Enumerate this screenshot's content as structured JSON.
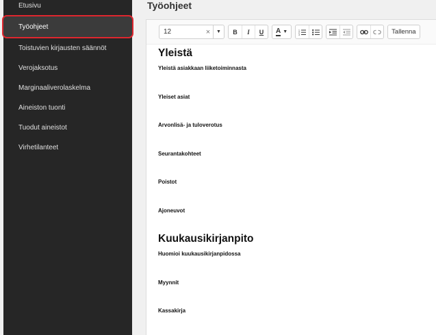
{
  "sidebar": {
    "items": [
      {
        "label": "Etusivu"
      },
      {
        "label": "Työohjeet",
        "active": true
      },
      {
        "label": "Toistuvien kirjausten säännöt"
      },
      {
        "label": "Verojaksotus"
      },
      {
        "label": "Marginaaliverolaskelma"
      },
      {
        "label": "Aineiston tuonti"
      },
      {
        "label": "Tuodut aineistot"
      },
      {
        "label": "Virhetilanteet"
      }
    ]
  },
  "page": {
    "title": "Työohjeet"
  },
  "toolbar": {
    "font_size": "12",
    "clear_glyph": "×",
    "dropdown_glyph": "▼",
    "bold": "B",
    "italic": "I",
    "underline": "U",
    "text_color": "A",
    "save_label": "Tallenna",
    "icons": [
      "numbered-list-icon",
      "bulleted-list-icon",
      "indent-icon",
      "outdent-icon",
      "link-icon",
      "unlink-icon"
    ]
  },
  "document": {
    "section1": {
      "heading": "Yleistä",
      "items": [
        "Yleistä asiakkaan liiketoiminnasta",
        "Yleiset asiat",
        "Arvonlisä- ja tuloverotus",
        "Seurantakohteet",
        "Poistot",
        "Ajoneuvot"
      ]
    },
    "section2": {
      "heading": "Kuukausikirjanpito",
      "items": [
        "Huomioi kuukausikirjanpidossa",
        "Myynnit",
        "Kassakirja"
      ]
    }
  },
  "colors": {
    "sidebar_bg": "#262626",
    "active_outline": "#e0262e",
    "page_bg": "#f0f0f0"
  }
}
